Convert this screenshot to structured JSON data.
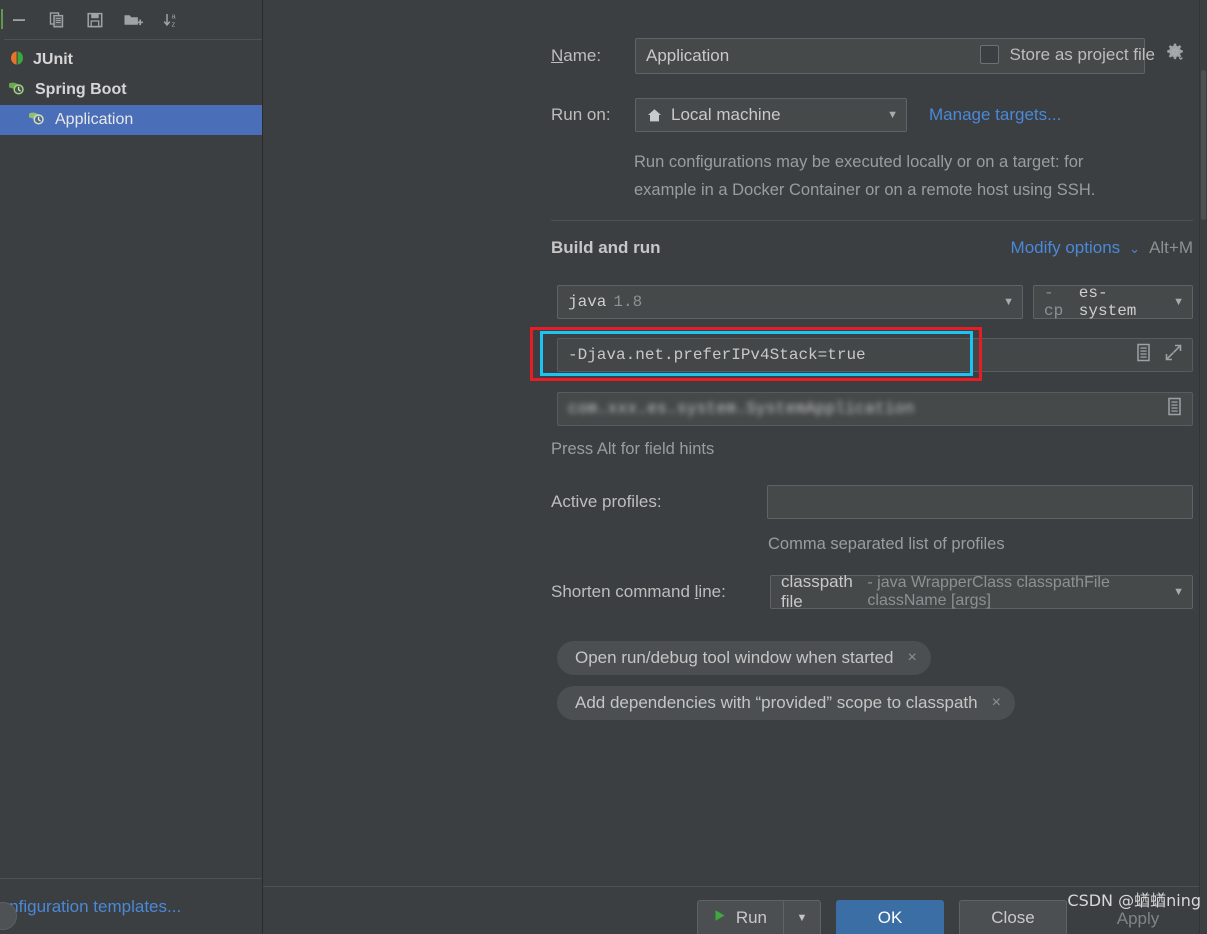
{
  "window": {
    "background": "#3c3f41",
    "accent_blue": "#4a88d8",
    "selection_blue": "#4a6fb8",
    "annotation_red": "#e81c24",
    "focus_cyan": "#1ec3f3"
  },
  "sidebar": {
    "toolbar": [
      {
        "name": "remove-icon",
        "title": "Remove"
      },
      {
        "name": "copy-icon",
        "title": "Copy Configuration"
      },
      {
        "name": "save-icon",
        "title": "Save Configuration"
      },
      {
        "name": "new-folder-icon",
        "title": "Create New Folder"
      },
      {
        "name": "sort-alphabetically-icon",
        "title": "Sort Configurations"
      }
    ],
    "items": [
      {
        "label": "JUnit",
        "icon": "junit-icon",
        "level": 1,
        "selected": false
      },
      {
        "label": "Spring Boot",
        "icon": "spring-boot-icon",
        "level": 1,
        "selected": false
      },
      {
        "label": "Application",
        "icon": "spring-boot-icon",
        "level": 2,
        "selected": true
      }
    ],
    "edit_templates_link": "it configuration templates..."
  },
  "form": {
    "name_label": "Name:",
    "name_value": "Application",
    "store_as_project_file_label": "Store as project file",
    "store_as_project_file_checked": false,
    "gear_icon": "gear-icon",
    "run_on_label": "Run on:",
    "run_on_value": "Local machine",
    "run_on_icon": "home-icon",
    "manage_targets_link": "Manage targets...",
    "hint_line_1": "Run configurations may be executed locally or on a target: for",
    "hint_line_2": "example in a Docker Container or on a remote host using SSH.",
    "section_title": "Build and run",
    "modify_options_link": "Modify options",
    "modify_options_shortcut": "Alt+M",
    "jre_name": "java",
    "jre_version": "1.8",
    "classpath_prefix": "-cp",
    "classpath_module": "es-system",
    "vm_options_value": "-Djava.net.preferIPv4Stack=true",
    "main_class_value": "com.xxx.es.system.SystemApplication",
    "press_alt_hint": "Press Alt for field hints",
    "active_profiles_label": "Active profiles:",
    "active_profiles_value": "",
    "active_profiles_hint": "Comma separated list of profiles",
    "shorten_command_line_label_pre": "Shorten command ",
    "shorten_command_line_label_u": "l",
    "shorten_command_line_label_post": "ine:",
    "shorten_command_line_value": "classpath file",
    "shorten_command_line_desc": "- java WrapperClass classpathFile className [args]",
    "chips": [
      {
        "label": "Open run/debug tool window when started",
        "close": "×"
      },
      {
        "label": "Add dependencies with “provided” scope to classpath",
        "close": "×"
      }
    ],
    "field_icons": {
      "expand_editor": "document-list-icon",
      "fullscreen": "expand-arrows-icon"
    }
  },
  "buttons": {
    "run": "Run",
    "run_dropdown_icon": "chevron-down-icon",
    "ok": "OK",
    "close": "Close",
    "apply": "Apply"
  },
  "watermark": "CSDN @蝤蝤ning"
}
